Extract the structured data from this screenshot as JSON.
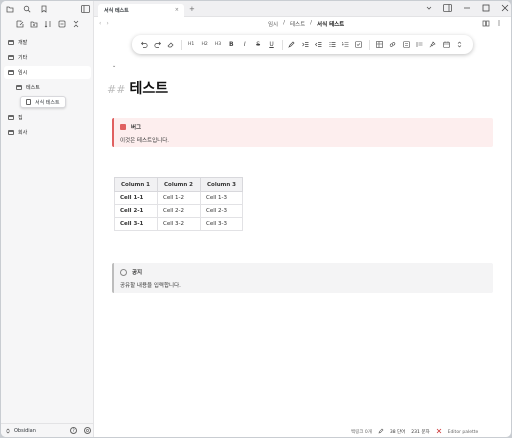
{
  "tabs": [
    {
      "label": "서식 테스트",
      "close": "×"
    }
  ],
  "new_tab": "+",
  "nav": {
    "back": "‹",
    "forward": "›"
  },
  "breadcrumb": {
    "items": [
      "임시",
      "테스트"
    ],
    "sep": "/",
    "current": "서식 테스트"
  },
  "sidebar": {
    "folders": [
      {
        "label": "개발"
      },
      {
        "label": "기타"
      },
      {
        "label": "임시"
      },
      {
        "label": "테스트"
      },
      {
        "label": "집"
      },
      {
        "label": "회사"
      }
    ],
    "open_file": "서식 테스트",
    "vault_name": "Obsidian",
    "help": "?"
  },
  "toolbar": {
    "buttons": [
      "H1",
      "H2",
      "H3",
      "B",
      "I",
      "S",
      "U"
    ]
  },
  "document": {
    "fold_marker": "⌄",
    "title_marker": "##",
    "title": "테스트",
    "bug_callout": {
      "title": "버그",
      "body": "이것은 테스트입니다."
    },
    "table": {
      "headers": [
        "Column 1",
        "Column 2",
        "Column 3"
      ],
      "rows": [
        [
          "Cell 1-1",
          "Cell 1-2",
          "Cell 1-3"
        ],
        [
          "Cell 2-1",
          "Cell 2-2",
          "Cell 2-3"
        ],
        [
          "Cell 3-1",
          "Cell 3-2",
          "Cell 3-3"
        ]
      ]
    },
    "note_callout": {
      "title": "공지",
      "body": "공유할 내용을 입력합니다."
    }
  },
  "status": {
    "backlinks": "백링크 0개",
    "words": "38 단어",
    "chars": "231 문자",
    "editor_palette": "Editor palette"
  },
  "colors": {
    "bug_accent": "#e06060",
    "bug_bg": "#fdeeee",
    "note_bg": "#f4f4f5",
    "sidebar_bg": "#f6f6f7"
  }
}
